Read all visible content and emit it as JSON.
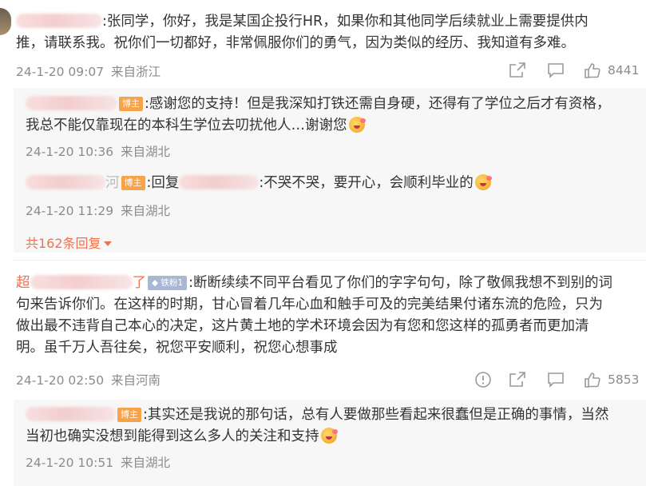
{
  "comments": [
    {
      "username_suffix": ":张同学，你好，我是某国企投行HR，如果你和其他同学后续就业上需要提供内",
      "text_line2": "推，请联系我。祝你们一切都好，非常佩服你们的勇气，因为类似的经历、我知道有多难。",
      "date": "24-1-20 09:07",
      "location": "来自浙江",
      "likes": "8441",
      "replies": [
        {
          "badge": "博主",
          "line1": ":感谢您的支持！但是我深知打铁还需自身硬，还得有了学位之后才有资格，",
          "line2": "我总不能仅靠现在的本科生学位去叨扰他人…谢谢您",
          "date": "24-1-20 10:36",
          "location": "来自湖北"
        },
        {
          "name_tail": "河",
          "badge": "博主",
          "reply_word": ":回复",
          "line1": ":不哭不哭，要开心，会顺利毕业的",
          "date": "24-1-20 11:29",
          "location": "来自湖北"
        }
      ],
      "more_replies": "共162条回复"
    },
    {
      "name_head": "超",
      "name_tail": "了",
      "fan_badge": "铁粉1",
      "line1": ":断断续续不同平台看见了你们的字字句句，除了敬佩我想不到别的词",
      "line2": "句来告诉你们。在这样的时期，甘心冒着几年心血和触手可及的完美结果付诸东流的危险，只为",
      "line3": "做出最不违背自己本心的决定，这片黄土地的学术环境会因为有您和您这样的孤勇者而更加清",
      "line4": "明。虽千万人吾往矣，祝您平安顺利，祝您心想事成",
      "date": "24-1-20 02:50",
      "location": "来自河南",
      "likes": "5853",
      "replies": [
        {
          "badge": "博主",
          "line1": ":其实还是我说的那句话，总有人要做那些看起来很蠢但是正确的事情，当然",
          "line2": "当初也确实没想到能得到这么多人的关注和支持",
          "date": "24-1-20 10:51",
          "location": "来自湖北"
        }
      ]
    }
  ],
  "icons": {
    "report": "report-icon",
    "share": "share-icon",
    "comment": "comment-icon",
    "like": "thumbs-up-icon"
  },
  "colors": {
    "accent_link": "#eb7350",
    "host_badge": "#f7a34b",
    "fan_badge": "#a7b7d4",
    "meta_text": "#8b8b8b",
    "reply_bg": "#f7f7f7"
  }
}
